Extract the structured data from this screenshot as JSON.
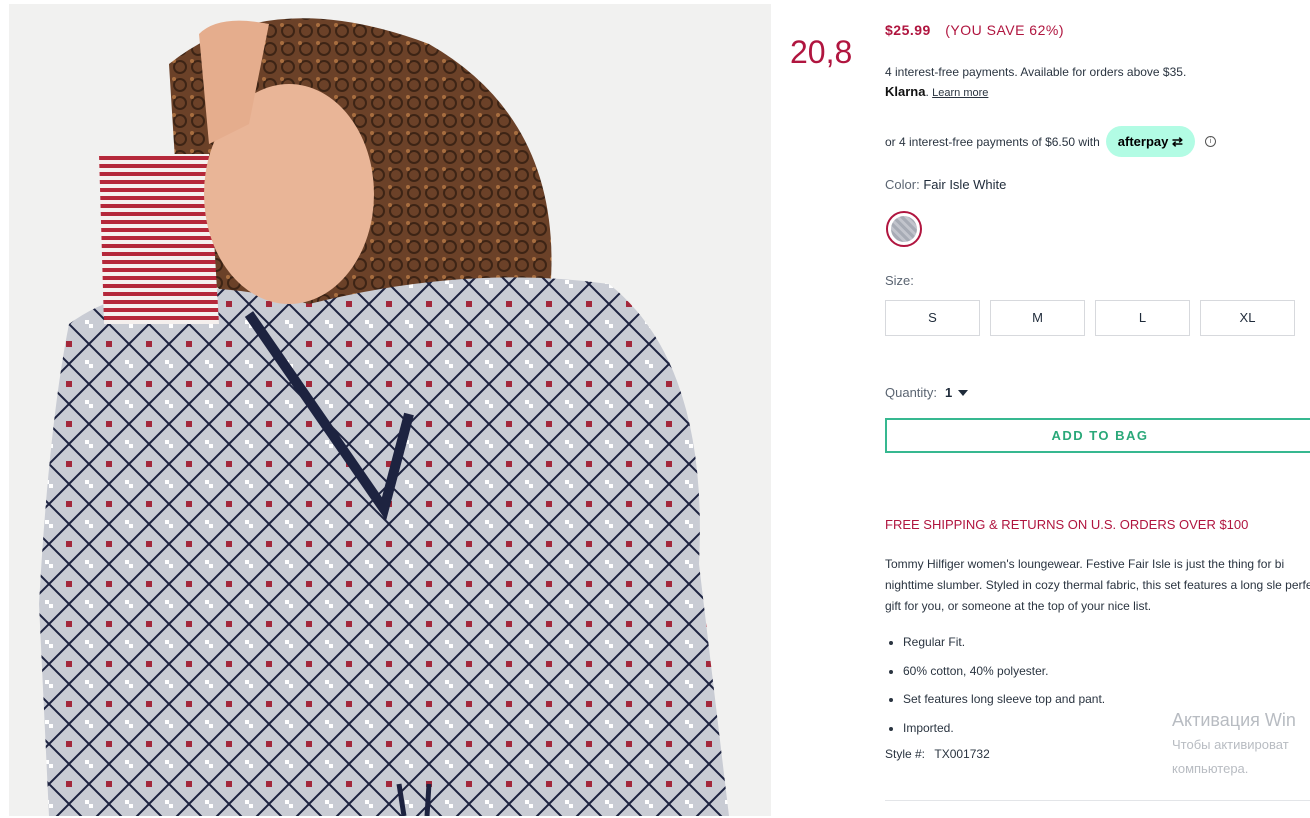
{
  "overlay_number": "20,8",
  "product": {
    "price": "$25.99",
    "savings": "(YOU SAVE 62%)",
    "klarna": {
      "line1": "4 interest-free payments. Available for orders above $35.",
      "brand": "Klarna",
      "learn_more": "Learn more"
    },
    "afterpay": {
      "text": "or 4 interest-free payments of $6.50 with",
      "badge": "afterpay",
      "info": "i"
    },
    "color": {
      "label": "Color:",
      "value": "Fair Isle White"
    },
    "size": {
      "label": "Size:",
      "options": [
        "S",
        "M",
        "L",
        "XL"
      ]
    },
    "quantity": {
      "label": "Quantity:",
      "value": "1"
    },
    "add_to_bag": "ADD TO BAG",
    "shipping": "FREE SHIPPING & RETURNS ON U.S. ORDERS OVER $100",
    "description": "Tommy Hilfiger women's loungewear. Festive Fair Isle is just the thing for bi nighttime slumber. Styled in cozy thermal fabric, this set features a long sle perfect gift for you, or someone at the top of your nice list.",
    "bullets": [
      "Regular Fit.",
      "60% cotton, 40% polyester.",
      "Set features long sleeve top and pant.",
      "Imported."
    ],
    "style": {
      "label": "Style #:",
      "code": "TX001732"
    }
  },
  "watermark": {
    "title": "Активация Win",
    "line1": "Чтобы активироват",
    "line2": "компьютера."
  },
  "colors": {
    "accent": "#b0153f",
    "cta": "#36b890",
    "afterpay": "#b2fce4"
  }
}
